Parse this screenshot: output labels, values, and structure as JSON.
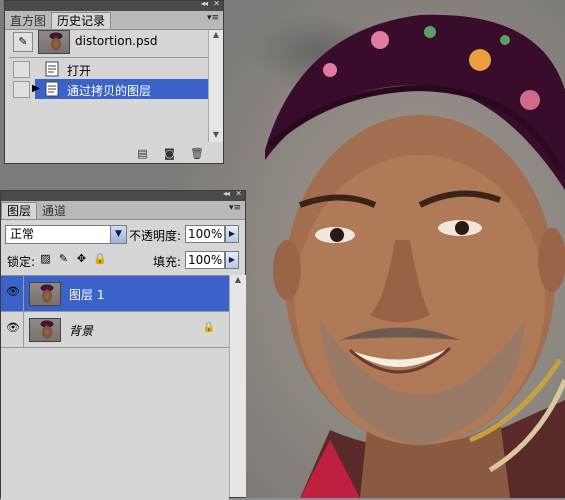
{
  "history_panel": {
    "tabs": [
      {
        "label": "直方图",
        "active": false
      },
      {
        "label": "历史记录",
        "active": true
      }
    ],
    "menu_icon": "panel-menu-icon",
    "snapshot": {
      "name": "distortion.psd"
    },
    "states": [
      {
        "label": "打开",
        "selected": false
      },
      {
        "label": "通过拷贝的图层",
        "selected": true
      }
    ],
    "footer_icons": [
      "new-document-icon",
      "camera-icon",
      "trash-icon"
    ]
  },
  "layers_panel": {
    "tabs": [
      {
        "label": "图层",
        "active": true
      },
      {
        "label": "通道",
        "active": false
      }
    ],
    "blend_mode": "正常",
    "opacity_label": "不透明度:",
    "opacity_value": "100%",
    "lock_label": "锁定:",
    "fill_label": "填充:",
    "fill_value": "100%",
    "lock_icons": [
      "lock-transparent-icon",
      "lock-brush-icon",
      "lock-move-icon",
      "lock-all-icon"
    ],
    "layers": [
      {
        "name": "图层 1",
        "selected": true,
        "visible": true,
        "locked": false,
        "italic": false
      },
      {
        "name": "背景",
        "selected": false,
        "visible": true,
        "locked": true,
        "italic": true
      }
    ]
  },
  "colors": {
    "selection": "#3a62c8",
    "panel_bg": "#d6d6d6",
    "title_bar": "#4a4a4a"
  }
}
